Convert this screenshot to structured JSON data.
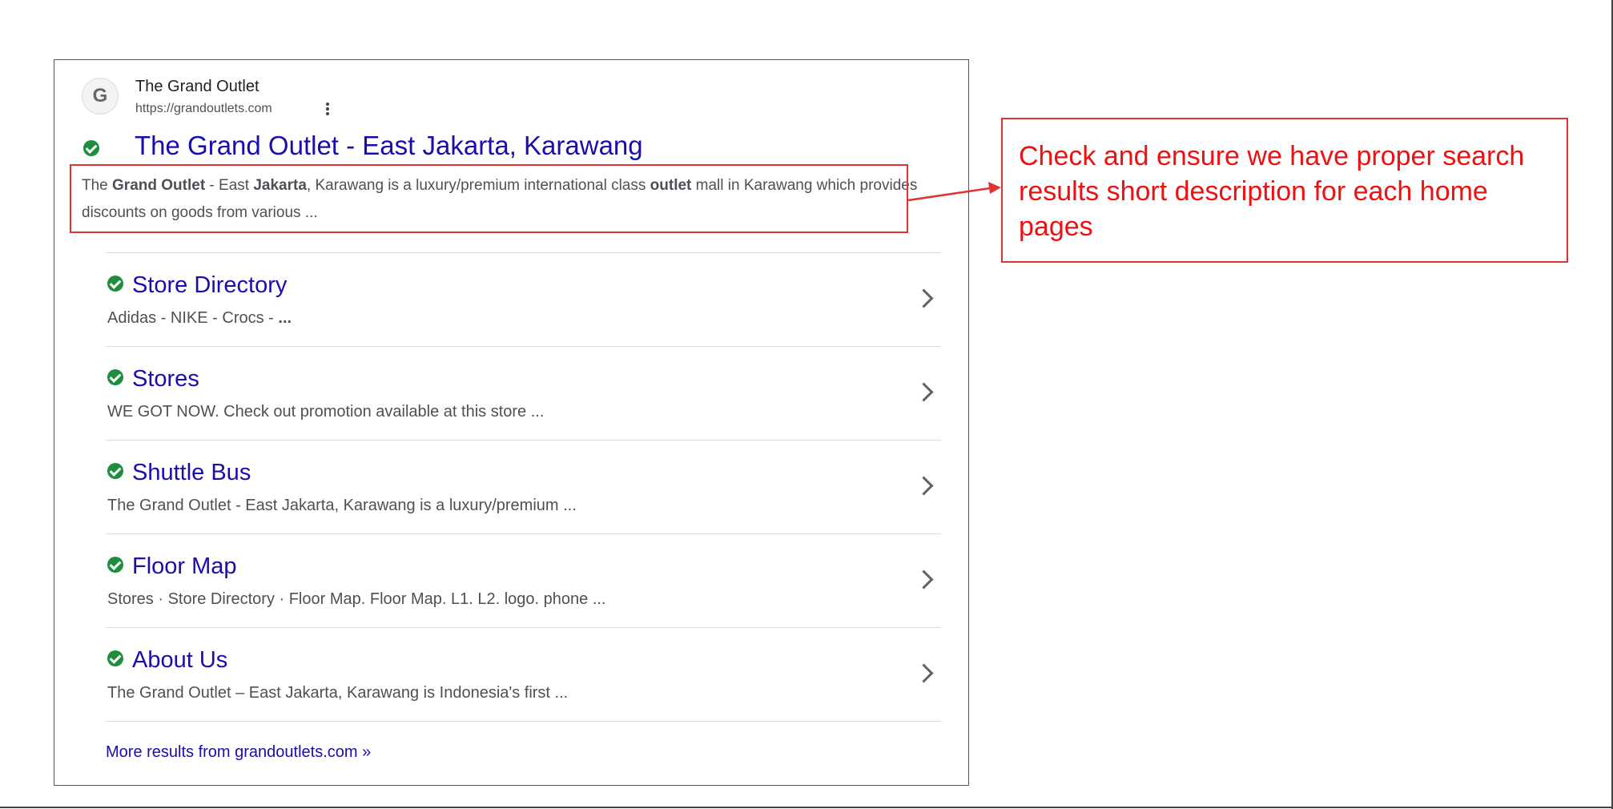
{
  "result": {
    "favicon_letter": "G",
    "site_name": "The Grand Outlet",
    "url": "https://grandoutlets.com",
    "title": "The Grand Outlet - East Jakarta, Karawang",
    "snippet": {
      "p1": "The ",
      "b1": "Grand Outlet",
      "p2": " - East ",
      "b2": "Jakarta",
      "p3": ", Karawang is a luxury/premium international class ",
      "b3": "outlet",
      "p4": " mall in Karawang which provides discounts on goods from various ..."
    }
  },
  "sitelinks": [
    {
      "title": "Store Directory",
      "desc": "Adidas - NIKE - Crocs - ",
      "desc_bold": "..."
    },
    {
      "title": "Stores",
      "desc": "WE GOT NOW. Check out promotion available at this store ...",
      "desc_bold": ""
    },
    {
      "title": "Shuttle Bus",
      "desc": "The Grand Outlet - East Jakarta, Karawang is a luxury/premium ...",
      "desc_bold": ""
    },
    {
      "title": "Floor Map",
      "desc": "Stores · Store Directory · Floor Map. Floor Map. L1. L2. logo. phone ...",
      "desc_bold": ""
    },
    {
      "title": "About Us",
      "desc": "The Grand Outlet – East Jakarta, Karawang is Indonesia's first ...",
      "desc_bold": ""
    }
  ],
  "more_results": "More results from grandoutlets.com »",
  "callout": {
    "text": "Check and ensure we have proper search results short description for each home pages"
  },
  "colors": {
    "link": "#1a0dab",
    "annotation": "#e03232",
    "verified": "#1e8e3e"
  }
}
